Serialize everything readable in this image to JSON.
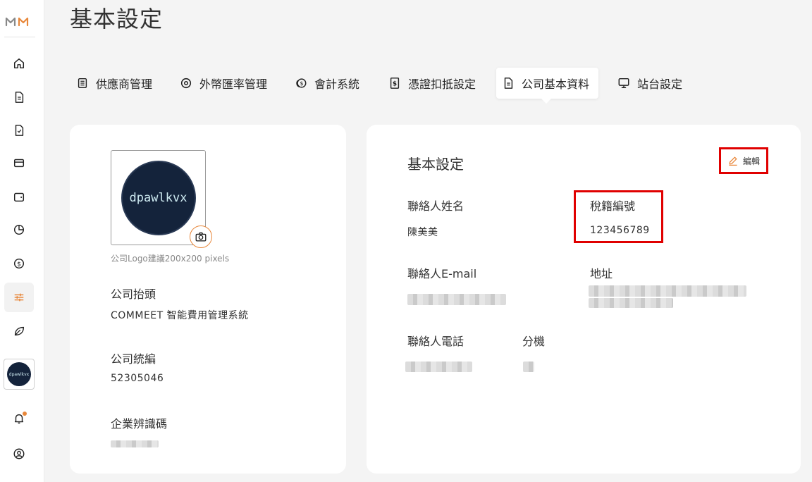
{
  "app": {
    "logo_text": "MM",
    "accent_color": "#e8873a",
    "highlight_color": "#e00000"
  },
  "page": {
    "title": "基本設定"
  },
  "tabs": [
    {
      "label": "供應商管理",
      "icon": "building-icon"
    },
    {
      "label": "外幣匯率管理",
      "icon": "currency-circle-icon"
    },
    {
      "label": "會計系統",
      "icon": "coins-icon"
    },
    {
      "label": "憑證扣抵設定",
      "icon": "dollar-doc-icon"
    },
    {
      "label": "公司基本資料",
      "icon": "document-icon",
      "active": true
    },
    {
      "label": "站台設定",
      "icon": "monitor-icon"
    }
  ],
  "left_card": {
    "logo_text": "dpawlkvx",
    "logo_hint": "公司Logo建議200x200 pixels",
    "company_header_label": "公司抬頭",
    "company_header_value": "COMMEET 智能費用管理系統",
    "tax_id_label": "公司統編",
    "tax_id_value": "52305046",
    "business_id_label": "企業辨識碼"
  },
  "right_card": {
    "section_title": "基本設定",
    "edit_label": "編輯",
    "contact_name_label": "聯絡人姓名",
    "contact_name_value": "陳美美",
    "tax_reg_label": "稅籍編號",
    "tax_reg_value": "123456789",
    "contact_email_label": "聯絡人E-mail",
    "address_label": "地址",
    "contact_phone_label": "聯絡人電話",
    "extension_label": "分機"
  },
  "sidebar": {
    "items": [
      "home-icon",
      "document-icon",
      "receipt-icon",
      "card-icon",
      "wallet-icon",
      "pie-chart-icon",
      "money-icon",
      "settings-sliders-icon",
      "leaf-icon"
    ],
    "avatar_text": "dpawlkvx"
  }
}
